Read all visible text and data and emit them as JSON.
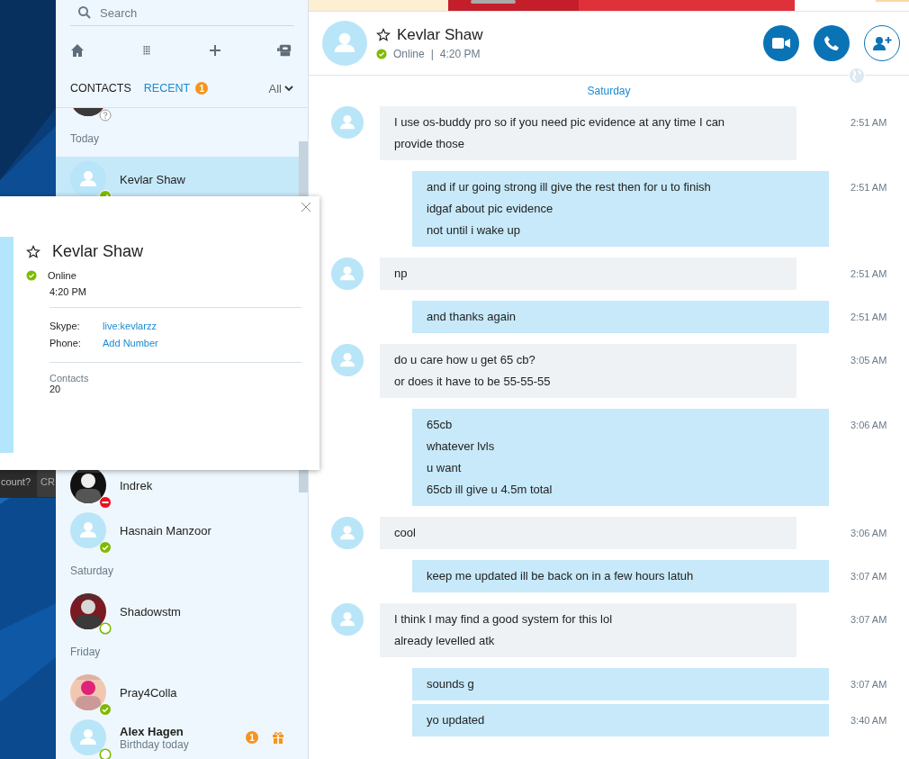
{
  "background_window": {
    "texts": [
      "count?",
      "CR"
    ]
  },
  "sidebar": {
    "search": {
      "placeholder": "Search"
    },
    "tabs": [
      {
        "label": "CONTACTS",
        "selected": false
      },
      {
        "label": "RECENT",
        "selected": true,
        "badge": "1"
      }
    ],
    "filter": "All",
    "list_before_popup": [
      {
        "kind": "contact",
        "status": {
          "kind": "unknown"
        },
        "selected": false
      },
      {
        "kind": "header",
        "label": "Today"
      },
      {
        "kind": "contact",
        "name": "Kevlar Shaw",
        "avatar": {
          "kind": "default"
        },
        "status": {
          "kind": "online"
        },
        "selected": true
      }
    ],
    "list_after_popup": [
      {
        "kind": "contact",
        "name": "Indrek",
        "status": {
          "kind": "busy"
        },
        "selected": false
      },
      {
        "kind": "contact",
        "name": "Hasnain  Manzoor",
        "avatar": {
          "kind": "default"
        },
        "status": {
          "kind": "online"
        },
        "selected": false
      },
      {
        "kind": "header",
        "label": "Saturday"
      },
      {
        "kind": "contact",
        "name": "Shadowstm",
        "status": {
          "kind": "ring"
        },
        "selected": false
      },
      {
        "kind": "header",
        "label": "Friday"
      },
      {
        "kind": "contact",
        "name": "Pray4Colla",
        "status": {
          "kind": "online"
        },
        "selected": false
      },
      {
        "kind": "contact",
        "name": "Alex Hagen",
        "subtitle": "Birthday today",
        "avatar": {
          "kind": "default"
        },
        "status": {
          "kind": "ring"
        },
        "selected": false,
        "unread": true,
        "badge": "1",
        "gift": true
      }
    ]
  },
  "popup": {
    "name": "Kevlar Shaw",
    "online": true,
    "status_label": "Online",
    "local_time": "4:20 PM",
    "fields": [
      {
        "label": "Skype:",
        "value": "live:kevlarzz"
      },
      {
        "label": "Phone:",
        "value": "Add Number"
      }
    ],
    "contacts_label": "Contacts",
    "contacts_count": "20"
  },
  "chat": {
    "name": "Kevlar Shaw",
    "online": true,
    "status_text": "Online",
    "separator": "|",
    "local_time": "4:20 PM",
    "date": "Saturday",
    "groups": [
      {
        "kind": "in",
        "messages": [
          {
            "lines": [
              "I use os-buddy pro so if you need pic evidence at any time I can",
              "provide those"
            ],
            "time": "2:51 AM"
          }
        ]
      },
      {
        "kind": "out",
        "messages": [
          {
            "lines": [
              "and if ur going strong ill give the rest then for u to finish",
              "idgaf about pic evidence",
              "not until i wake up"
            ],
            "time": "2:51 AM"
          }
        ]
      },
      {
        "kind": "in",
        "messages": [
          {
            "lines": [
              "np"
            ],
            "time": "2:51 AM"
          }
        ]
      },
      {
        "kind": "out",
        "messages": [
          {
            "lines": [
              "and thanks again"
            ],
            "time": "2:51 AM"
          }
        ]
      },
      {
        "kind": "in",
        "messages": [
          {
            "lines": [
              "do u care how u get 65 cb?",
              "or does it have to be 55-55-55"
            ],
            "time": "3:05 AM"
          }
        ]
      },
      {
        "kind": "out",
        "messages": [
          {
            "lines": [
              "65cb",
              "whatever lvls",
              "u want",
              "65cb ill give u 4.5m total"
            ],
            "time": "3:06 AM"
          }
        ]
      },
      {
        "kind": "in",
        "messages": [
          {
            "lines": [
              "cool"
            ],
            "time": "3:06 AM"
          }
        ]
      },
      {
        "kind": "out",
        "messages": [
          {
            "lines": [
              "keep me updated ill be back on in a few hours latuh"
            ],
            "time": "3:07 AM"
          }
        ]
      },
      {
        "kind": "in",
        "messages": [
          {
            "lines": [
              "I think I may find a good system for this lol",
              "already levelled atk"
            ],
            "time": "3:07 AM"
          }
        ]
      },
      {
        "kind": "out",
        "messages": [
          {
            "lines": [
              "sounds g"
            ],
            "time": "3:07 AM"
          },
          {
            "lines": [
              "yo updated"
            ],
            "time": "3:40 AM"
          }
        ]
      }
    ]
  }
}
